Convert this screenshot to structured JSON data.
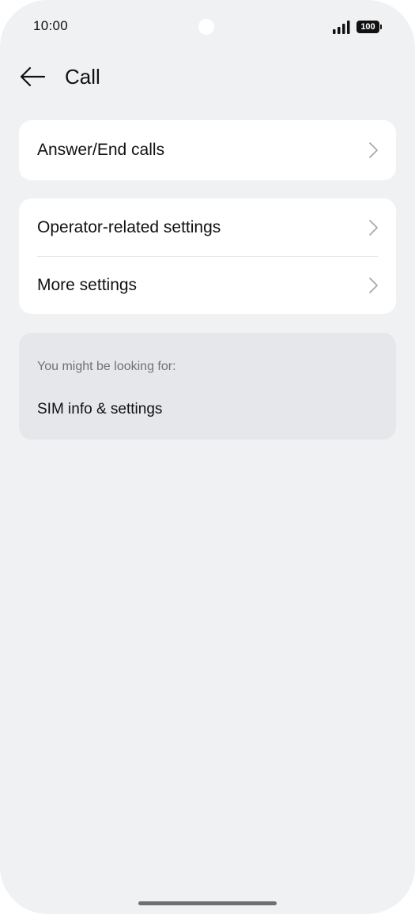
{
  "status_bar": {
    "time": "10:00",
    "battery": "100",
    "icons": [
      "signal-icon",
      "battery-icon"
    ]
  },
  "header": {
    "title": "Call",
    "back_icon": "arrow-left-icon"
  },
  "groups": [
    {
      "items": [
        {
          "label": "Answer/End calls",
          "icon": "chevron-right-icon"
        }
      ]
    },
    {
      "items": [
        {
          "label": "Operator-related settings",
          "icon": "chevron-right-icon"
        },
        {
          "label": "More settings",
          "icon": "chevron-right-icon"
        }
      ]
    }
  ],
  "suggestions": {
    "heading": "You might be looking for:",
    "items": [
      {
        "label": "SIM info & settings"
      }
    ]
  },
  "colors": {
    "background": "#f0f1f3",
    "card": "#ffffff",
    "suggestion_card": "#e6e7ea",
    "text": "#111111",
    "secondary_text": "#6f7176"
  }
}
